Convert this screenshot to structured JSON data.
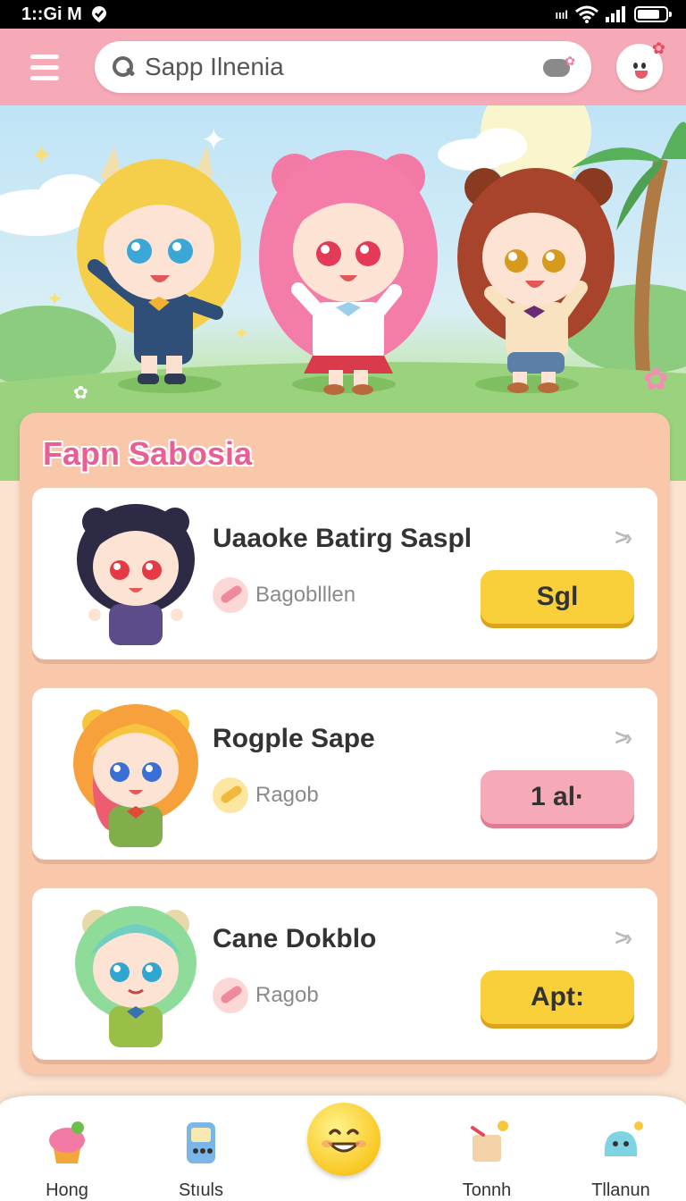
{
  "status_bar": {
    "left_text": "1::Gi M",
    "signal_label": "ıııl"
  },
  "header": {
    "search_placeholder": "Sapp Ilnenia"
  },
  "panel": {
    "title": "Fapn Sabosia",
    "cards": [
      {
        "title": "Uaaoke Batirg Saspl",
        "subtitle": "Bagoblllen",
        "button_label": "Sgl",
        "button_color": "#f9cf3a",
        "hair_color": "#2d2a45"
      },
      {
        "title": "Rogple Sape",
        "subtitle": "Ragob",
        "button_label": "1 al·",
        "button_color": "#f6aab8",
        "hair_color": "#f7c440"
      },
      {
        "title": "Cane Dokblo",
        "subtitle": "Ragob",
        "button_label": "Apt:",
        "button_color": "#f9cf3a",
        "hair_color": "#8fdc9a"
      }
    ]
  },
  "bottom_nav": {
    "items": [
      {
        "label": "Hong",
        "icon": "cupcake-icon"
      },
      {
        "label": "Stıuls",
        "icon": "handheld-console-icon"
      },
      {
        "label": "",
        "icon": "smiley-face-icon"
      },
      {
        "label": "Tonnh",
        "icon": "gift-box-icon"
      },
      {
        "label": "Tllanun",
        "icon": "blue-creature-icon"
      }
    ]
  },
  "colors": {
    "header_pink": "#f6a9b6",
    "panel_peach": "#f9c7aa",
    "title_pink": "#e85f94",
    "button_yellow": "#f9cf3a",
    "button_pink": "#f6aab8"
  }
}
